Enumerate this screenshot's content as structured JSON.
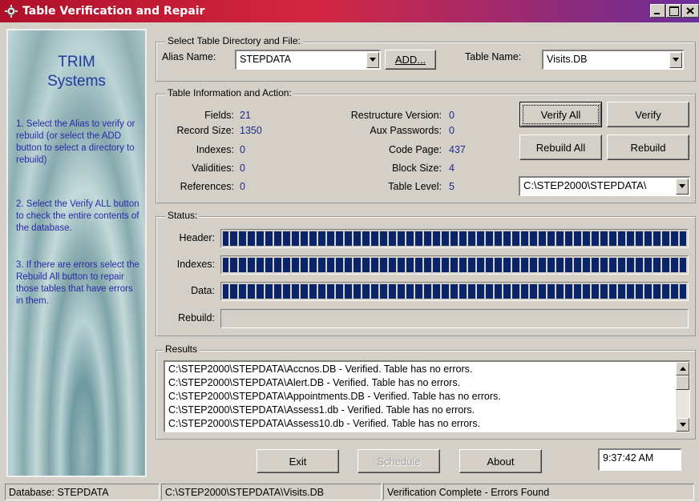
{
  "window": {
    "title": "Table Verification and Repair"
  },
  "sidebar": {
    "brand_line1": "TRIM",
    "brand_line2": "Systems",
    "steps": [
      "1.  Select the Alias to verify or rebuild (or select the ADD button to select a directory to rebuild)",
      "2. Select the Verify ALL button to check the entire contents of the database.",
      "3. If there are errors select the Rebuild All button to repair those tables that have errors in them."
    ]
  },
  "select_group": {
    "legend": "Select Table Directory and File:",
    "alias_label": "Alias Name:",
    "alias_value": "STEPDATA",
    "add_button": "ADD...",
    "table_label": "Table Name:",
    "table_value": "Visits.DB"
  },
  "info_group": {
    "legend": "Table Information and Action:",
    "left": [
      {
        "label": "Fields:",
        "value": "21"
      },
      {
        "label": "Record Size:",
        "value": "1350"
      },
      {
        "label": "Indexes:",
        "value": "0"
      },
      {
        "label": "Validities:",
        "value": "0"
      },
      {
        "label": "References:",
        "value": "0"
      }
    ],
    "right": [
      {
        "label": "Restructure Version:",
        "value": "0"
      },
      {
        "label": "Aux Passwords:",
        "value": "0"
      },
      {
        "label": "Code Page:",
        "value": "437"
      },
      {
        "label": "Block Size:",
        "value": "4"
      },
      {
        "label": "Table Level:",
        "value": "5"
      }
    ],
    "verify_all": "Verify All",
    "verify": "Verify",
    "rebuild_all": "Rebuild All",
    "rebuild": "Rebuild",
    "path_value": "C:\\STEP2000\\STEPDATA\\"
  },
  "status_group": {
    "legend": "Status:",
    "bars": [
      {
        "label": "Header:",
        "progress": 1.0
      },
      {
        "label": "Indexes:",
        "progress": 1.0
      },
      {
        "label": "Data:",
        "progress": 1.0
      },
      {
        "label": "Rebuild:",
        "progress": 0.0
      }
    ]
  },
  "results_group": {
    "legend": "Results",
    "lines": [
      "C:\\STEP2000\\STEPDATA\\Accnos.DB - Verified. Table has no errors.",
      "C:\\STEP2000\\STEPDATA\\Alert.DB - Verified. Table has no errors.",
      "C:\\STEP2000\\STEPDATA\\Appointments.DB - Verified. Table has no errors.",
      "C:\\STEP2000\\STEPDATA\\Assess1.db - Verified. Table has no errors.",
      "C:\\STEP2000\\STEPDATA\\Assess10.db - Verified. Table has no errors."
    ]
  },
  "footer": {
    "exit": "Exit",
    "schedule": "Schedule",
    "about": "About",
    "clock": "9:37:42 AM"
  },
  "statusbar": {
    "database": "Database: STEPDATA",
    "path": "C:\\STEP2000\\STEPDATA\\Visits.DB",
    "message": "Verification Complete - Errors Found"
  }
}
